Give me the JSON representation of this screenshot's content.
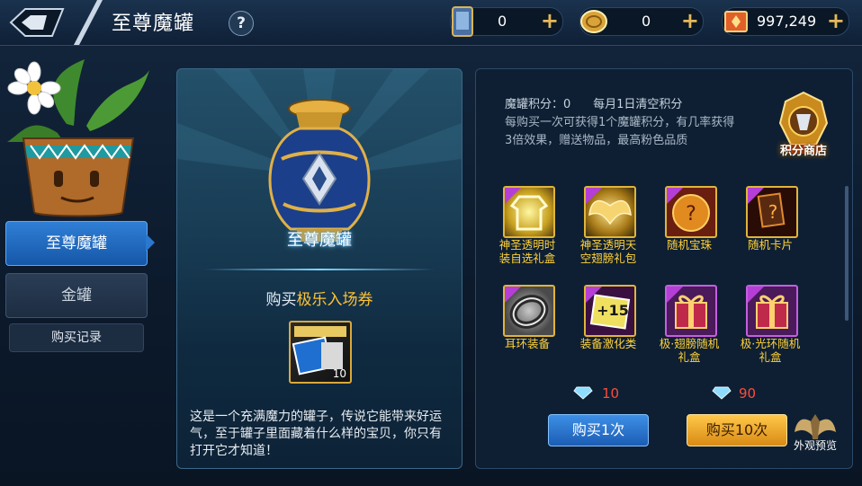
{
  "header": {
    "title": "至尊魔罐",
    "help_label": "?",
    "currencies": [
      {
        "icon": "card-ticket-icon",
        "value": "0"
      },
      {
        "icon": "coin-icon",
        "value": "0"
      },
      {
        "icon": "gem-scroll-icon",
        "value": "997,249"
      }
    ],
    "plus_label": "+"
  },
  "left": {
    "tabs": [
      {
        "label": "至尊魔罐",
        "active": true
      },
      {
        "label": "金罐",
        "active": false
      }
    ],
    "record_label": "购买记录"
  },
  "middle": {
    "jar_label": "至尊魔罐",
    "buy_prefix": "购买",
    "buy_highlight": "极乐入场券",
    "ticket_count": "10",
    "description": "这是一个充满魔力的罐子，传说它能带来好运气，至于罐子里面藏着什么样的宝贝，你只有打开它才知道！"
  },
  "right": {
    "score_line": "魔罐积分：0      每月1日清空积分",
    "rule_text": "每购买一次可获得1个魔罐积分，有几率获得3倍效果，赠送物品，最高粉色品质",
    "shop_label": "积分商店",
    "items": [
      {
        "name": "神圣透明时装自选礼盒",
        "icon": "costume-icon",
        "rarity": "gold"
      },
      {
        "name": "神圣透明天空翅膀礼包",
        "icon": "wings-icon",
        "rarity": "gold"
      },
      {
        "name": "随机宝珠",
        "icon": "orb-icon",
        "rarity": "gold"
      },
      {
        "name": "随机卡片",
        "icon": "card-icon",
        "rarity": "gold"
      },
      {
        "name": "耳环装备",
        "icon": "earring-icon",
        "rarity": "gold"
      },
      {
        "name": "装备激化类",
        "icon": "enhance-icon",
        "rarity": "gold"
      },
      {
        "name": "极·翅膀随机礼盒",
        "icon": "gift-box-icon",
        "rarity": "purple"
      },
      {
        "name": "极·光环随机礼盒",
        "icon": "gift-box-icon",
        "rarity": "purple"
      }
    ],
    "price_once": "10",
    "price_ten": "90",
    "buy_once_label": "购买1次",
    "buy_ten_label": "购买10次",
    "preview_label": "外观预览"
  },
  "colors": {
    "accent_gold": "#ffc233",
    "price_red": "#ff4b3a",
    "button_blue": "#2f7fd6"
  }
}
